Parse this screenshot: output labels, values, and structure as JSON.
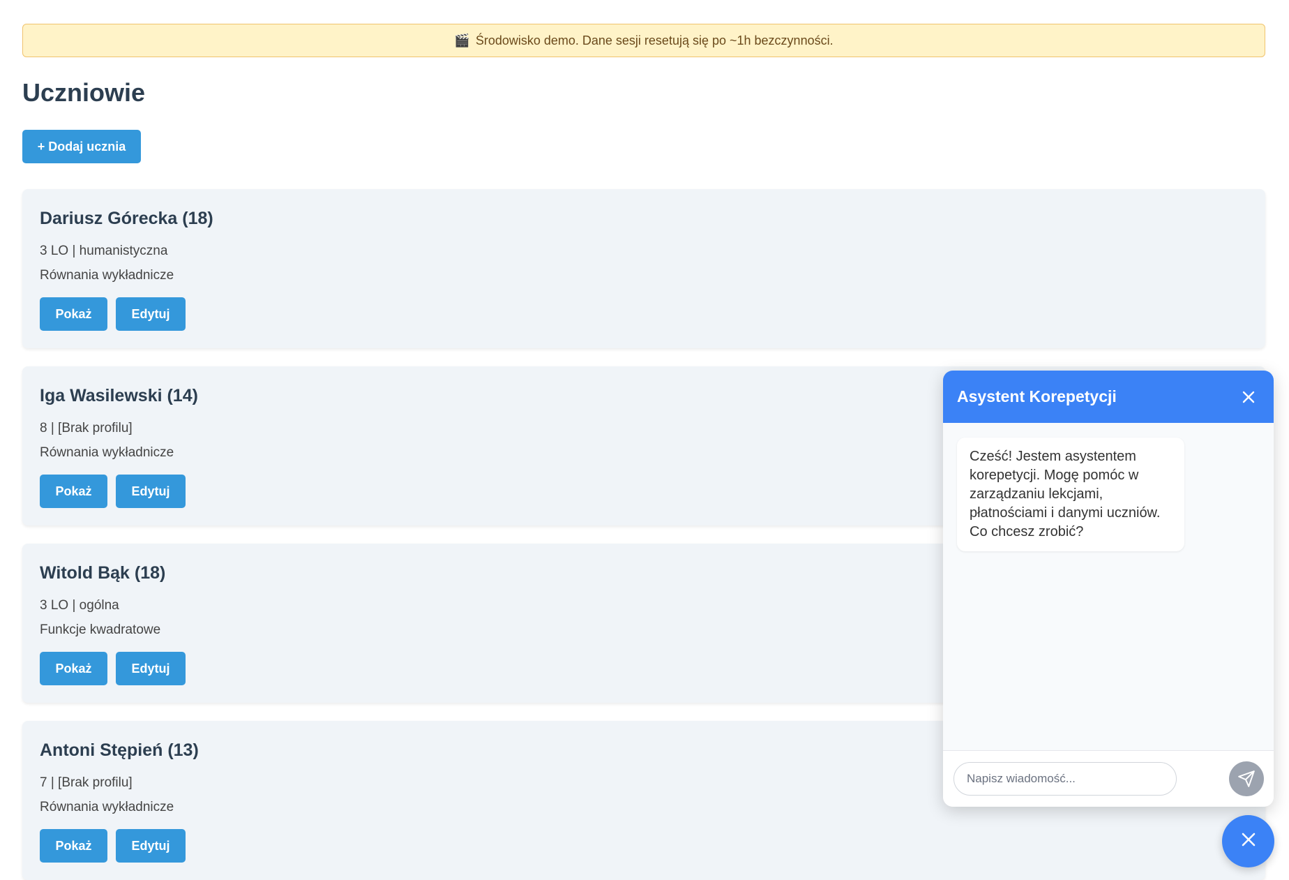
{
  "banner": {
    "icon": "clapperboard-icon",
    "text": "Środowisko demo. Dane sesji resetują się po ~1h bezczynności."
  },
  "page": {
    "title": "Uczniowie",
    "add_button": "+ Dodaj ucznia"
  },
  "students": [
    {
      "name": "Dariusz Górecka (18)",
      "meta": "3 LO | humanistyczna",
      "topic": "Równania wykładnicze",
      "show": "Pokaż",
      "edit": "Edytuj"
    },
    {
      "name": "Iga Wasilewski (14)",
      "meta": "8 | [Brak profilu]",
      "topic": "Równania wykładnicze",
      "show": "Pokaż",
      "edit": "Edytuj"
    },
    {
      "name": "Witold Bąk (18)",
      "meta": "3 LO | ogólna",
      "topic": "Funkcje kwadratowe",
      "show": "Pokaż",
      "edit": "Edytuj"
    },
    {
      "name": "Antoni Stępień (13)",
      "meta": "7 | [Brak profilu]",
      "topic": "Równania wykładnicze",
      "show": "Pokaż",
      "edit": "Edytuj"
    }
  ],
  "chat": {
    "title": "Asystent Korepetycji",
    "greeting": "Cześć! Jestem asystentem korepetycji. Mogę pomóc w zarządzaniu lekcjami, płatnościami i danymi uczniów. Co chcesz zrobić?",
    "input_placeholder": "Napisz wiadomość...",
    "close_icon": "close-icon",
    "send_icon": "send-icon"
  },
  "fab": {
    "icon": "close-icon"
  },
  "colors": {
    "primary": "#3498db",
    "chat_accent": "#3b82f6",
    "banner_bg": "#fff3c8",
    "card_bg": "#f0f4f8"
  }
}
